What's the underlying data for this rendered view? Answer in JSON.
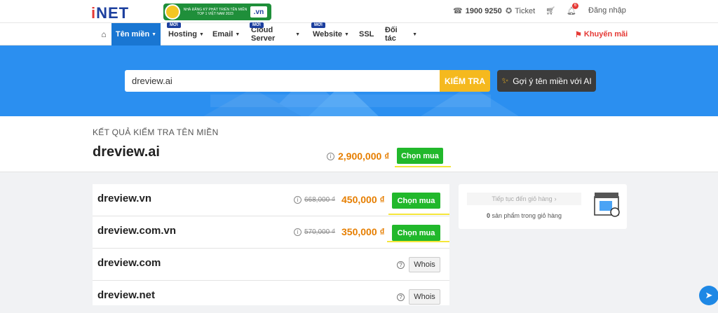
{
  "header": {
    "logo": "iNET",
    "logo_i": "i",
    "logo_rest": "NET",
    "award_text": "NHÀ ĐĂNG KÝ PHÁT TRIỂN TÊN MIỀN TOP 1 VIỆT NAM 2023",
    "award_vn": ".vn",
    "phone": "1900 9250",
    "ticket": "Ticket",
    "notification_count": "6",
    "login": "Đăng nhập"
  },
  "nav": {
    "items": [
      {
        "label": "Tên miền",
        "new": ""
      },
      {
        "label": "Hosting",
        "new": "MỚI"
      },
      {
        "label": "Email",
        "new": ""
      },
      {
        "label": "Cloud Server",
        "new": "MỚI"
      },
      {
        "label": "Website",
        "new": "MỚI"
      },
      {
        "label": "SSL",
        "new": ""
      },
      {
        "label": "Đối tác",
        "new": ""
      }
    ],
    "promo": "Khuyến mãi"
  },
  "search": {
    "value": "dreview.ai",
    "button": "KIỂM TRA",
    "ai_button": "Gợi ý tên miền với AI"
  },
  "result": {
    "label": "KẾT QUẢ KIỂM TRA TÊN MIỀN",
    "domain": "dreview.ai",
    "price": "2,900,000 ₫",
    "buy": "Chọn mua"
  },
  "list": [
    {
      "domain": "dreview.vn",
      "old_price": "668,000 ₫",
      "price": "450,000 ₫",
      "action": "Chọn mua"
    },
    {
      "domain": "dreview.com.vn",
      "old_price": "570,000 ₫",
      "price": "350,000 ₫",
      "action": "Chọn mua"
    },
    {
      "domain": "dreview.com",
      "action": "Whois"
    },
    {
      "domain": "dreview.net",
      "action": "Whois"
    }
  ],
  "cart": {
    "continue": "Tiếp tục đến giỏ hàng",
    "count_num": "0",
    "count_text": "sản phẩm trong giỏ hàng"
  },
  "colors": {
    "primary": "#1976d2",
    "buy": "#21b82b",
    "price": "#e67e00",
    "search_btn": "#f5b91e",
    "highlight": "#f5e63a"
  }
}
